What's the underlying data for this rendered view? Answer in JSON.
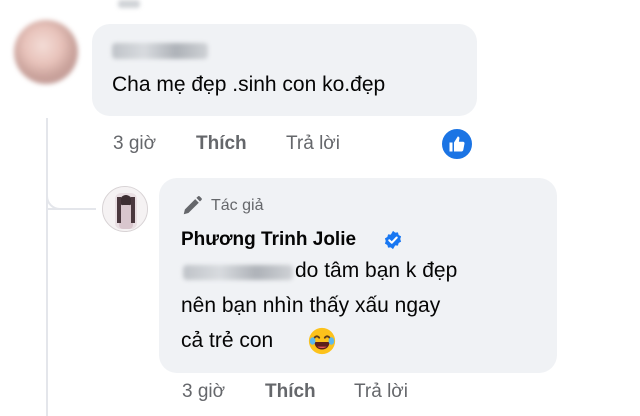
{
  "comment": {
    "text": "Cha mẹ đẹp .sinh con ko.đẹp",
    "time": "3 giờ",
    "like_label": "Thích",
    "reply_label": "Trả lời"
  },
  "reply": {
    "author_tag": "Tác giả",
    "author_name": "Phương Trinh Jolie",
    "text_line1": "do tâm bạn k đẹp",
    "text_line2": "nên bạn nhìn thấy xấu ngay",
    "text_line3": "cả trẻ con",
    "time": "3 giờ",
    "like_label": "Thích",
    "reply_label": "Trả lời"
  },
  "colors": {
    "bubble": "#f0f2f5",
    "meta": "#65676b",
    "like_blue": "#1b74e4",
    "verified_blue": "#1877f2"
  },
  "icons": [
    "like-thumb-icon",
    "pencil-icon",
    "verified-badge-icon",
    "laughing-emoji-icon"
  ]
}
